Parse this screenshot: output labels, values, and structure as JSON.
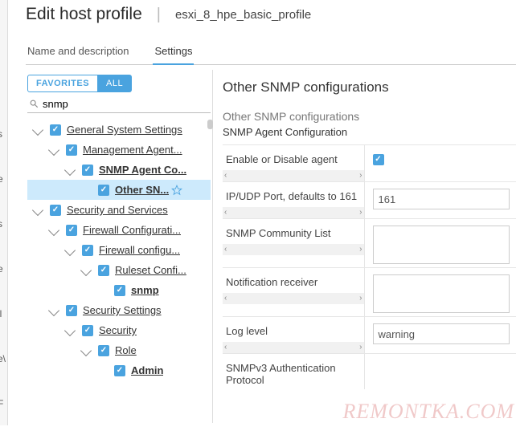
{
  "header": {
    "title": "Edit host profile",
    "profile_name": "esxi_8_hpe_basic_profile"
  },
  "tabs": {
    "t1": "Name and description",
    "t2": "Settings"
  },
  "sidebar": {
    "pill_fav": "FAVORITES",
    "pill_all": "ALL",
    "search_value": "snmp",
    "nodes": {
      "gss": "General System Settings",
      "ma": "Management Agent...",
      "snmp_agent": "SNMP Agent Co...",
      "other_sn": "Other SN...",
      "secserv": "Security and Services",
      "fw_conf": "Firewall Configurati...",
      "fw_conf2": "Firewall configu...",
      "ruleset": "Ruleset Confi...",
      "snmp": "snmp",
      "sec_set": "Security Settings",
      "security": "Security",
      "role": "Role",
      "admin": "Admin"
    }
  },
  "main": {
    "title": "Other SNMP configurations",
    "sub1": "Other SNMP configurations",
    "sub2": "SNMP Agent Configuration",
    "rows": {
      "enable": "Enable or Disable agent",
      "port": "IP/UDP Port, defaults to 161",
      "port_val": "161",
      "community": "SNMP Community List",
      "notif": "Notification receiver",
      "loglevel": "Log level",
      "loglevel_val": "warning",
      "v3auth": "SNMPv3 Authentication Protocol"
    }
  },
  "watermark": "REMONTKA.COM"
}
